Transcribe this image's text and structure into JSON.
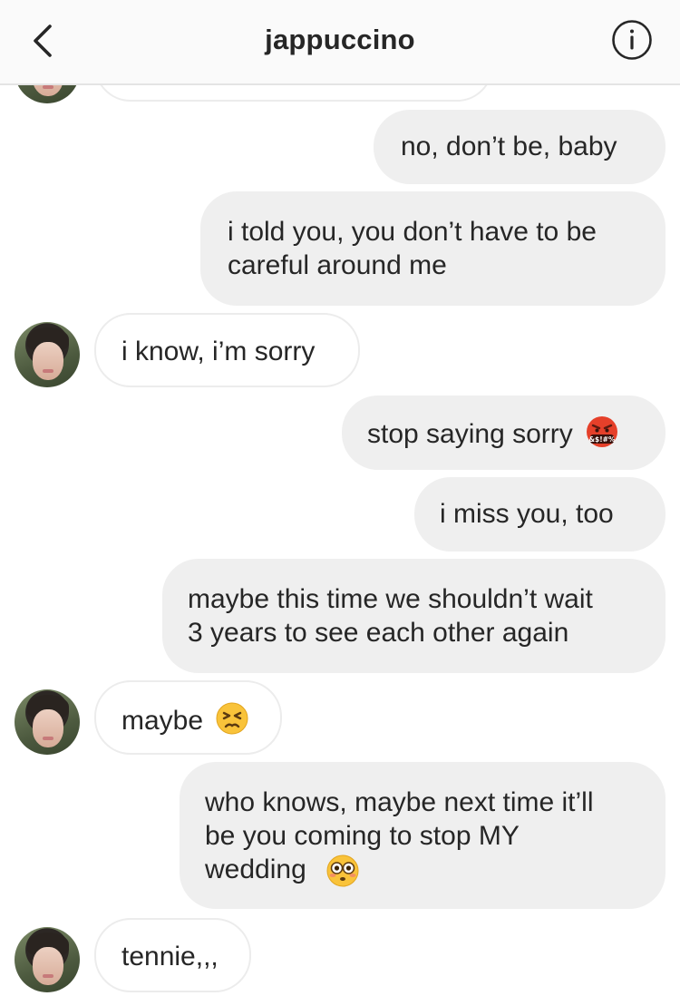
{
  "header": {
    "title": "jappuccino",
    "back_icon": "chevron-left-icon",
    "info_icon": "info-icon"
  },
  "messages": [
    {
      "from": "them",
      "text": ""
    },
    {
      "from": "me",
      "text": "no, don’t be, baby"
    },
    {
      "from": "me",
      "text": "i told you, you don’t have to be\ncareful around me"
    },
    {
      "from": "them",
      "text": "i know, i’m sorry"
    },
    {
      "from": "me",
      "text": "stop saying sorry",
      "emoji": "face-with-symbols-on-mouth"
    },
    {
      "from": "me",
      "text": "i miss you, too"
    },
    {
      "from": "me",
      "text": "maybe this time we shouldn’t wait\n3 years to see each other again"
    },
    {
      "from": "them",
      "text": "maybe",
      "emoji": "persevering-face"
    },
    {
      "from": "me",
      "text": "who knows, maybe next time it’ll\nbe you coming to stop MY\nwedding",
      "emoji": "flushed-face"
    },
    {
      "from": "them",
      "text": "tennie,,,"
    }
  ],
  "colors": {
    "header_bg": "#fafafa",
    "outgoing_bubble": "#efefef",
    "incoming_border": "#ececec",
    "text": "#262626"
  }
}
